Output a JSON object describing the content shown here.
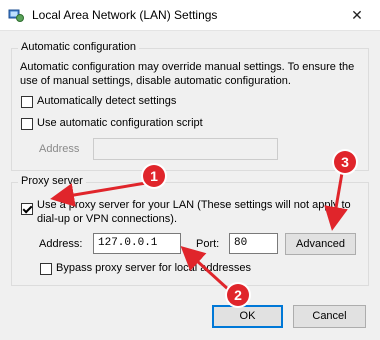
{
  "window": {
    "title": "Local Area Network (LAN) Settings",
    "close_glyph": "✕"
  },
  "auto_config": {
    "legend": "Automatic configuration",
    "description": "Automatic configuration may override manual settings.  To ensure the use of manual settings, disable automatic configuration.",
    "detect_label": "Automatically detect settings",
    "detect_checked": false,
    "script_label": "Use automatic configuration script",
    "script_checked": false,
    "address_label": "Address",
    "address_value": ""
  },
  "proxy": {
    "legend": "Proxy server",
    "use_proxy_label": "Use a proxy server for your LAN (These settings will not apply to dial-up or VPN connections).",
    "use_proxy_checked": true,
    "address_label": "Address:",
    "address_value": "127.0.0.1",
    "port_label": "Port:",
    "port_value": "80",
    "advanced_label": "Advanced",
    "bypass_label": "Bypass proxy server for local addresses",
    "bypass_checked": false
  },
  "buttons": {
    "ok_label": "OK",
    "cancel_label": "Cancel"
  },
  "annotations": {
    "marker_1": "1",
    "marker_2": "2",
    "marker_3": "3",
    "color": "#e0252b"
  },
  "icons": {
    "app": "network-settings-icon",
    "close": "close-icon"
  }
}
